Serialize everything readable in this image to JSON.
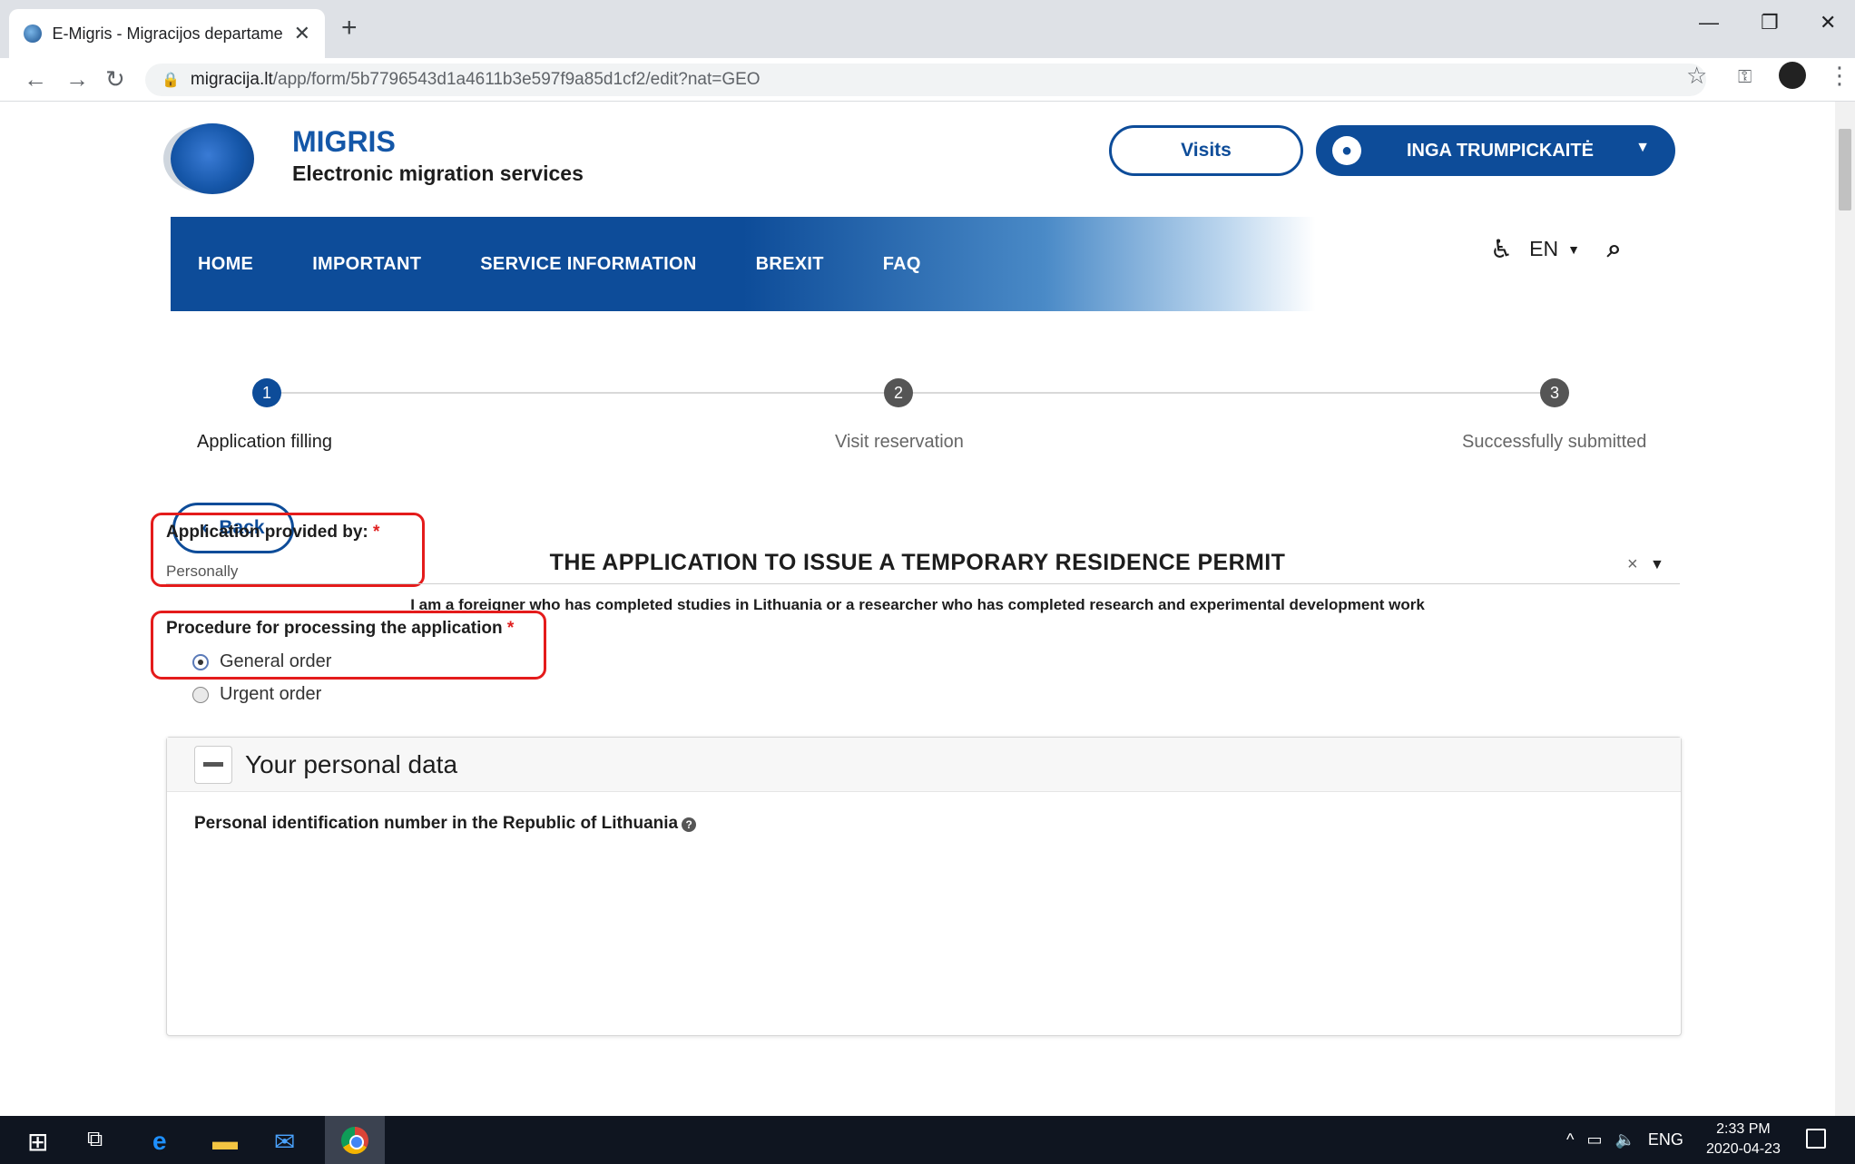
{
  "browser": {
    "tab_title": "E-Migris - Migracijos departamer",
    "url_host": "migracija.lt",
    "url_path": "/app/form/5b7796543d1a4611b3e597f9a85d1cf2/edit?nat=GEO",
    "icons": [
      "back-icon",
      "forward-icon",
      "reload-icon",
      "lock-icon",
      "star-icon",
      "key-icon",
      "menu-icon"
    ]
  },
  "header": {
    "site_name": "MIGRIS",
    "site_subtitle": "Electronic migration services",
    "visits_label": "Visits",
    "user_name": "INGA TRUMPICKAITĖ"
  },
  "nav": {
    "items": [
      "HOME",
      "IMPORTANT",
      "SERVICE INFORMATION",
      "BREXIT",
      "FAQ"
    ],
    "language": "EN",
    "brand_color": "#0d4c99"
  },
  "stepper": {
    "steps": [
      {
        "number": "1",
        "label": "Application filling"
      },
      {
        "number": "2",
        "label": "Visit reservation"
      },
      {
        "number": "3",
        "label": "Successfully submitted"
      }
    ],
    "active_color": "#0d4c99",
    "inactive_color": "#555555"
  },
  "form": {
    "back_label": "Back",
    "title": "THE APPLICATION TO ISSUE A TEMPORARY RESIDENCE PERMIT",
    "subtitle": "I am a foreigner who has completed studies in Lithuania or a researcher who has completed research and experimental development work",
    "provided_by_label": "Application provided by:",
    "provided_by_value": "Personally",
    "required_mark": "*",
    "clear_symbol": "×",
    "procedure_label": "Procedure for processing the application",
    "options": [
      "General order",
      "Urgent order"
    ]
  },
  "panel": {
    "title": "Your personal data",
    "pid_label": "Personal identification number in the Republic of Lithuania"
  },
  "taskbar": {
    "time": "2:33 PM",
    "date": "2020-04-23",
    "lang": "ENG"
  }
}
